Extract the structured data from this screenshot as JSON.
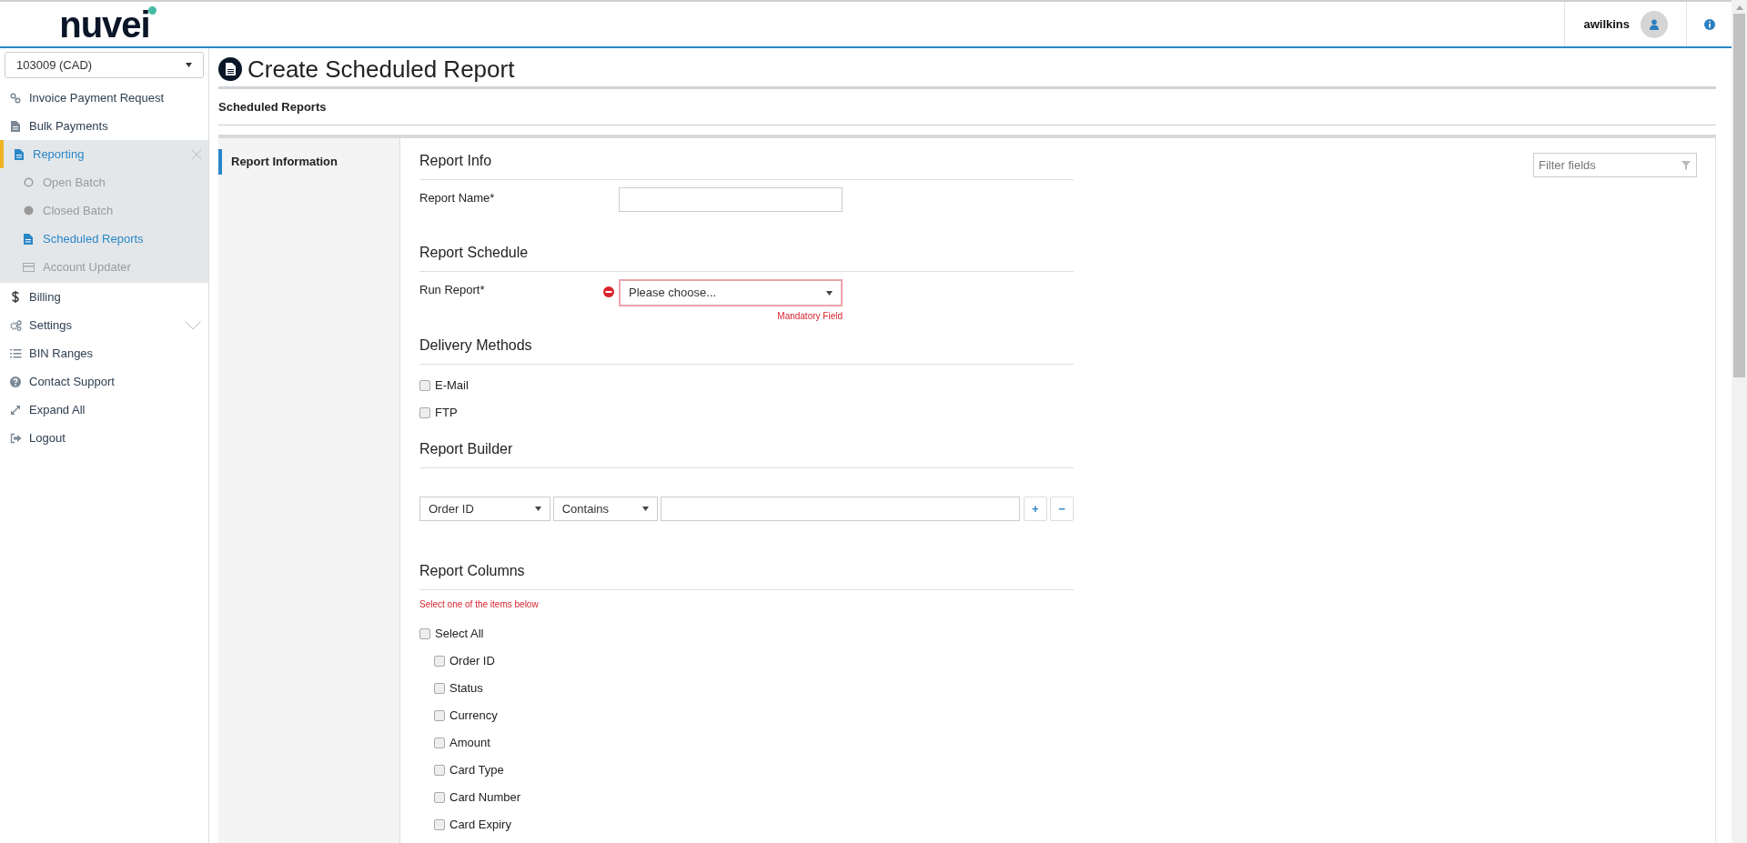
{
  "header": {
    "logo": "nuvei",
    "username": "awilkins"
  },
  "sidebar": {
    "account_select": "103009 (CAD)",
    "items": [
      {
        "label": "Invoice Payment Request",
        "selected": false
      },
      {
        "label": "Bulk Payments",
        "selected": false
      },
      {
        "label": "Reporting",
        "selected": true,
        "expanded": true,
        "children": [
          {
            "label": "Open Batch",
            "selected": false
          },
          {
            "label": "Closed Batch",
            "selected": false
          },
          {
            "label": "Scheduled Reports",
            "selected": true
          },
          {
            "label": "Account Updater",
            "selected": false
          }
        ]
      },
      {
        "label": "Billing",
        "selected": false
      },
      {
        "label": "Settings",
        "selected": false,
        "expanded": false
      },
      {
        "label": "BIN Ranges",
        "selected": false
      },
      {
        "label": "Contact Support",
        "selected": false
      },
      {
        "label": "Expand All",
        "selected": false
      },
      {
        "label": "Logout",
        "selected": false
      }
    ]
  },
  "page_title": "Create Scheduled Report",
  "breadcrumb": "Scheduled Reports",
  "side_tabs": [
    {
      "label": "Report Information",
      "selected": true
    }
  ],
  "filter": {
    "placeholder": "Filter fields"
  },
  "sections": [
    {
      "kind": "fields",
      "heading": "Report Info",
      "fields": [
        {
          "kind": "text",
          "label": "Report Name*"
        }
      ]
    },
    {
      "kind": "fields",
      "heading": "Report Schedule",
      "fields": [
        {
          "kind": "select",
          "label": "Run Report*",
          "value": "Please choose...",
          "error": "Mandatory Field"
        }
      ]
    },
    {
      "kind": "checks",
      "heading": "Delivery Methods",
      "options": [
        {
          "label": "E-Mail",
          "checked": false
        },
        {
          "label": "FTP",
          "checked": false
        }
      ]
    },
    {
      "kind": "builder",
      "heading": "Report Builder",
      "field": "Order ID",
      "operator": "Contains",
      "add": "+",
      "remove": "−"
    },
    {
      "kind": "columns",
      "heading": "Report Columns",
      "hint": "Select one of the items below",
      "select_all": {
        "label": "Select All",
        "checked": false
      },
      "columns": [
        {
          "label": "Order ID",
          "checked": false
        },
        {
          "label": "Status",
          "checked": false
        },
        {
          "label": "Currency",
          "checked": false
        },
        {
          "label": "Amount",
          "checked": false
        },
        {
          "label": "Card Type",
          "checked": false
        },
        {
          "label": "Card Number",
          "checked": false
        },
        {
          "label": "Card Expiry",
          "checked": false
        }
      ]
    }
  ]
}
